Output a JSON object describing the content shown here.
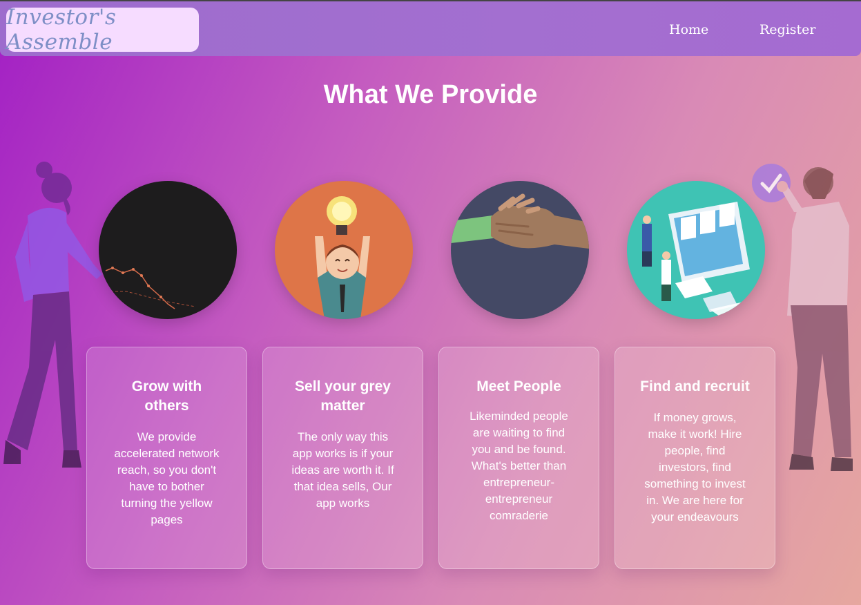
{
  "navbar": {
    "logo_text": "Investor's Assemble",
    "links": [
      "Home",
      "Register"
    ]
  },
  "section": {
    "title": "What We Provide"
  },
  "cards": [
    {
      "title": "Grow with others",
      "text": "We provide accelerated network reach, so you don't have to bother turning the yellow pages",
      "image": "stock-chart-graphic"
    },
    {
      "title": "Sell your grey matter",
      "text": "The only way this app works is if your ideas are worth it. If that idea sells, Our app works",
      "image": "idea-lightbulb-person"
    },
    {
      "title": "Meet People",
      "text": "Likeminded people are waiting to find you and be found. What's better than entrepreneur-entrepreneur comraderie",
      "image": "handshake"
    },
    {
      "title": "Find and recruit",
      "text": "If money grows, make it work! Hire people, find investors, find something to invest in. We are here for your endeavours",
      "image": "recruiting-computer-screen"
    }
  ],
  "colors": {
    "background_start": "#a21fc4",
    "background_end": "#e6a79f",
    "navbar": "#a36fd0",
    "logo_bg": "#f6dcff",
    "logo_text": "#7e8fc6"
  }
}
